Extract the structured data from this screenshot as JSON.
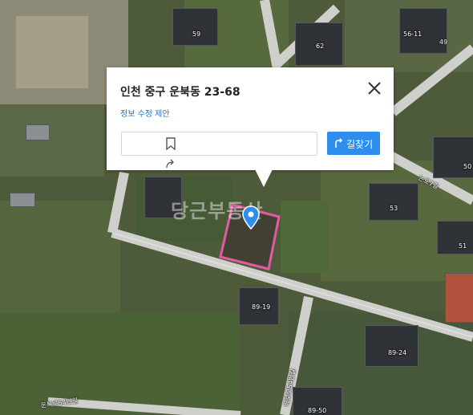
{
  "popup": {
    "address": "인천 중구 운북동 23-68",
    "edit_link": "정보 수정 제안",
    "directions_label": "길찾기"
  },
  "watermark": "당근부동산",
  "parcel_labels": [
    "59",
    "62",
    "56-11",
    "49",
    "50",
    "53",
    "51",
    "89-19",
    "89-24",
    "89-50"
  ],
  "road_labels": [
    "운북로54번길",
    "배로로54번길",
    "논로7길"
  ],
  "colors": {
    "parcel_outline": "#e35aa0",
    "marker": "#2d8ef0",
    "link": "#1a73c9",
    "button": "#2d8ef0"
  },
  "icons": [
    "close-icon",
    "bookmark-icon",
    "share-icon",
    "directions-icon",
    "location-marker-icon"
  ]
}
